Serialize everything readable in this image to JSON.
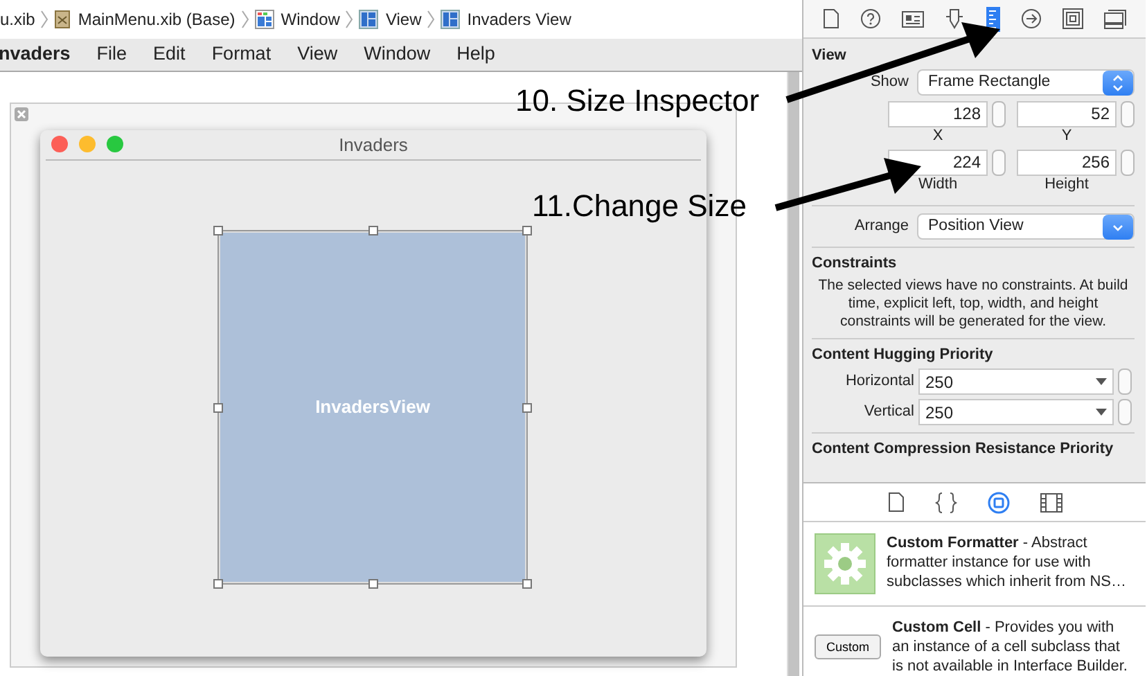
{
  "breadcrumb": [
    {
      "kind": "plain",
      "label": "u.xib"
    },
    {
      "kind": "xib",
      "label": "MainMenu.xib (Base)"
    },
    {
      "kind": "window",
      "label": "Window"
    },
    {
      "kind": "view",
      "label": "View"
    },
    {
      "kind": "view",
      "label": "Invaders View"
    }
  ],
  "menu_bar": {
    "app_name": "nvaders",
    "items": [
      "File",
      "Edit",
      "Format",
      "View",
      "Window",
      "Help"
    ]
  },
  "canvas": {
    "window": {
      "title": "Invaders",
      "view": {
        "label": "InvadersView",
        "selected": true
      }
    }
  },
  "annotations": [
    {
      "text": "10. Size Inspector"
    },
    {
      "text": "11.Change Size"
    }
  ],
  "inspector": {
    "tabs": [
      {
        "kind": "file",
        "selected": false
      },
      {
        "kind": "help",
        "selected": false
      },
      {
        "kind": "identity",
        "selected": false
      },
      {
        "kind": "attributes",
        "selected": false
      },
      {
        "kind": "size",
        "selected": true
      },
      {
        "kind": "connections",
        "selected": false
      },
      {
        "kind": "bindings",
        "selected": false
      },
      {
        "kind": "effects",
        "selected": false
      }
    ],
    "section_title": "View",
    "show": {
      "label": "Show",
      "value": "Frame Rectangle"
    },
    "fields": [
      {
        "value": "128",
        "label": "X"
      },
      {
        "value": "52",
        "label": "Y"
      },
      {
        "value": "224",
        "label": "Width"
      },
      {
        "value": "256",
        "label": "Height"
      }
    ],
    "arrange": {
      "label": "Arrange",
      "value": "Position View"
    },
    "constraints": {
      "title": "Constraints",
      "text": "The selected views have no constraints. At build time, explicit left, top, width, and height constraints will be generated for the view."
    },
    "priority_groups": [
      {
        "title": "Content Hugging Priority",
        "rows": [
          {
            "label": "Horizontal",
            "value": "250"
          },
          {
            "label": "Vertical",
            "value": "250"
          }
        ]
      },
      {
        "title": "Content Compression Resistance Priority"
      }
    ]
  },
  "library": {
    "tabs": [
      {
        "kind": "file",
        "selected": false
      },
      {
        "kind": "braces",
        "selected": false
      },
      {
        "kind": "object",
        "selected": true
      },
      {
        "kind": "media",
        "selected": false
      }
    ],
    "items": [
      {
        "kind": "gear",
        "text": "**Custom Formatter** - Abstract formatter instance for use with subclasses which inherit from NS…"
      },
      {
        "kind": "button",
        "button_label": "Custom",
        "text": "**Custom Cell** - Provides you with an instance of a cell subclass that is not available in Interface Builder."
      }
    ]
  }
}
